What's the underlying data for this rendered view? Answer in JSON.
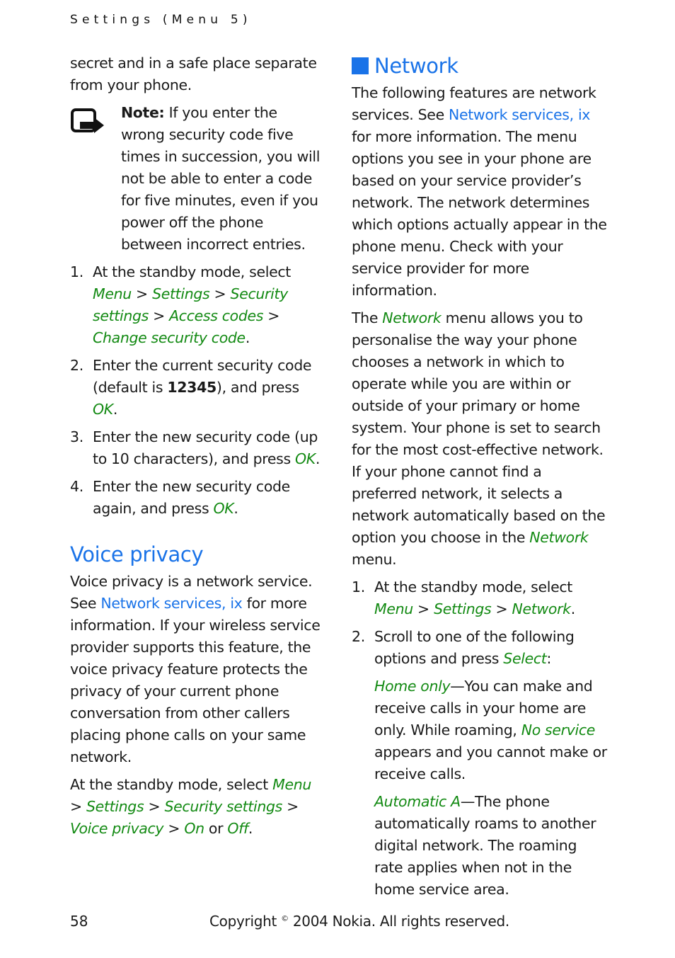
{
  "header": {
    "running_head": "Settings (Menu 5)"
  },
  "left": {
    "intro": "secret and in a safe place separate from your phone.",
    "note": {
      "label": "Note:",
      "text": " If you enter the wrong security code five times in succession, you will not be able to enter a code for five minutes, even if you power off the phone between incorrect entries."
    },
    "steps": [
      {
        "num": "1.",
        "a": "At the standby mode, select ",
        "ui1": "Menu",
        "s1": " > ",
        "ui2": "Settings",
        "s2": " > ",
        "ui3": "Security settings",
        "s3": " > ",
        "ui4": "Access codes",
        "s4": " > ",
        "ui5": "Change security code",
        "end": "."
      },
      {
        "num": "2.",
        "a": "Enter the current security code (default is ",
        "code": "12345",
        "b": "), and press ",
        "ui": "OK",
        "end": "."
      },
      {
        "num": "3.",
        "a": "Enter the new security code (up to 10 characters), and press ",
        "ui": "OK",
        "end": "."
      },
      {
        "num": "4.",
        "a": "Enter the new security code again, and press ",
        "ui": "OK",
        "end": "."
      }
    ],
    "voice_privacy": {
      "heading": "Voice privacy",
      "p1a": "Voice privacy is a network service. See ",
      "p1link": "Network services, ix",
      "p1b": " for more information. If your wireless service provider supports this feature, the voice privacy feature protects the privacy of your current phone conversation from other callers placing phone calls on your same network.",
      "p2a": "At the standby mode, select ",
      "ui1": "Menu",
      "s1": " > ",
      "ui2": "Settings",
      "s2": " > ",
      "ui3": "Security settings",
      "s3": " > ",
      "ui4": "Voice privacy",
      "s4": " > ",
      "ui5": "On",
      "s5": " or ",
      "ui6": "Off",
      "end": "."
    }
  },
  "right": {
    "heading": "Network",
    "p1a": "The following features are network services. See ",
    "p1link": "Network services, ix",
    "p1b": " for more information. The menu options you see in your phone are based on your service provider’s network. The network determines which options actually appear in the phone menu. Check with your service provider for more information.",
    "p2a": "The ",
    "p2ui": "Network",
    "p2b": " menu allows you to personalise the way your phone chooses a network in which to operate while you are within or outside of your primary or home system. Your phone is set to search for the most cost-effective network. If your phone cannot find a preferred network, it selects a network automatically based on the option you choose in the ",
    "p2ui2": "Network",
    "p2c": " menu.",
    "steps": [
      {
        "num": "1.",
        "a": "At the standby mode, select ",
        "ui1": "Menu",
        "s1": " > ",
        "ui2": "Settings",
        "s2": " > ",
        "ui3": "Network",
        "end": "."
      },
      {
        "num": "2.",
        "a": "Scroll to one of the following options and press ",
        "ui": "Select",
        "end": ":"
      }
    ],
    "options": [
      {
        "name": "Home only",
        "a": "—You can make and receive calls in your home are only. While roaming, ",
        "ui": "No service",
        "b": " appears and you cannot make or receive calls."
      },
      {
        "name": "Automatic A",
        "a": "—The phone automatically roams to another digital network. The roaming rate applies when not in the home service area."
      }
    ]
  },
  "footer": {
    "page_number": "58",
    "copyright_a": "Copyright ",
    "copyright_sym": "©",
    "copyright_b": " 2004 Nokia. All rights reserved."
  },
  "colors": {
    "link_blue": "#1a73e8",
    "ui_green": "#138a13",
    "text": "#1a1a1a"
  }
}
